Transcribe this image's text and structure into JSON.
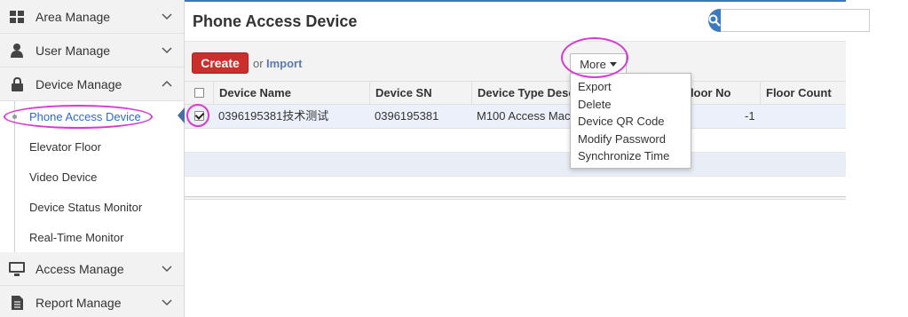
{
  "sidebar": {
    "groups": [
      {
        "label": "Area Manage",
        "icon": "grid-icon"
      },
      {
        "label": "User Manage",
        "icon": "user-icon"
      },
      {
        "label": "Device Manage",
        "icon": "lock-icon"
      },
      {
        "label": "Access Manage",
        "icon": "monitor-icon"
      },
      {
        "label": "Report Manage",
        "icon": "document-icon"
      }
    ],
    "sub_items": [
      {
        "label": "Phone Access Device",
        "active": true
      },
      {
        "label": "Elevator Floor"
      },
      {
        "label": "Video Device"
      },
      {
        "label": "Device Status Monitor"
      },
      {
        "label": "Real-Time Monitor"
      }
    ]
  },
  "main": {
    "title": "Phone Access Device",
    "search": {
      "value": "",
      "placeholder": ""
    }
  },
  "toolbar": {
    "create_label": "Create",
    "or_label": "or",
    "import_label": "Import",
    "more_label": "More"
  },
  "table": {
    "columns": [
      "Device Name",
      "Device SN",
      "Device Type Desc",
      "Floor No",
      "Floor Count"
    ],
    "rows": [
      {
        "checked": true,
        "device_name": "0396195381技术测试",
        "device_sn": "0396195381",
        "device_type": "M100 Access Mac",
        "floor_no": "-1",
        "floor_count": ""
      }
    ]
  },
  "dropdown": {
    "items": [
      "Export",
      "Delete",
      "Device QR Code",
      "Modify Password",
      "Synchronize Time"
    ]
  },
  "colors": {
    "accent": "#3a7bbf",
    "create_button": "#c9302c",
    "annotation": "#d63ad1"
  }
}
